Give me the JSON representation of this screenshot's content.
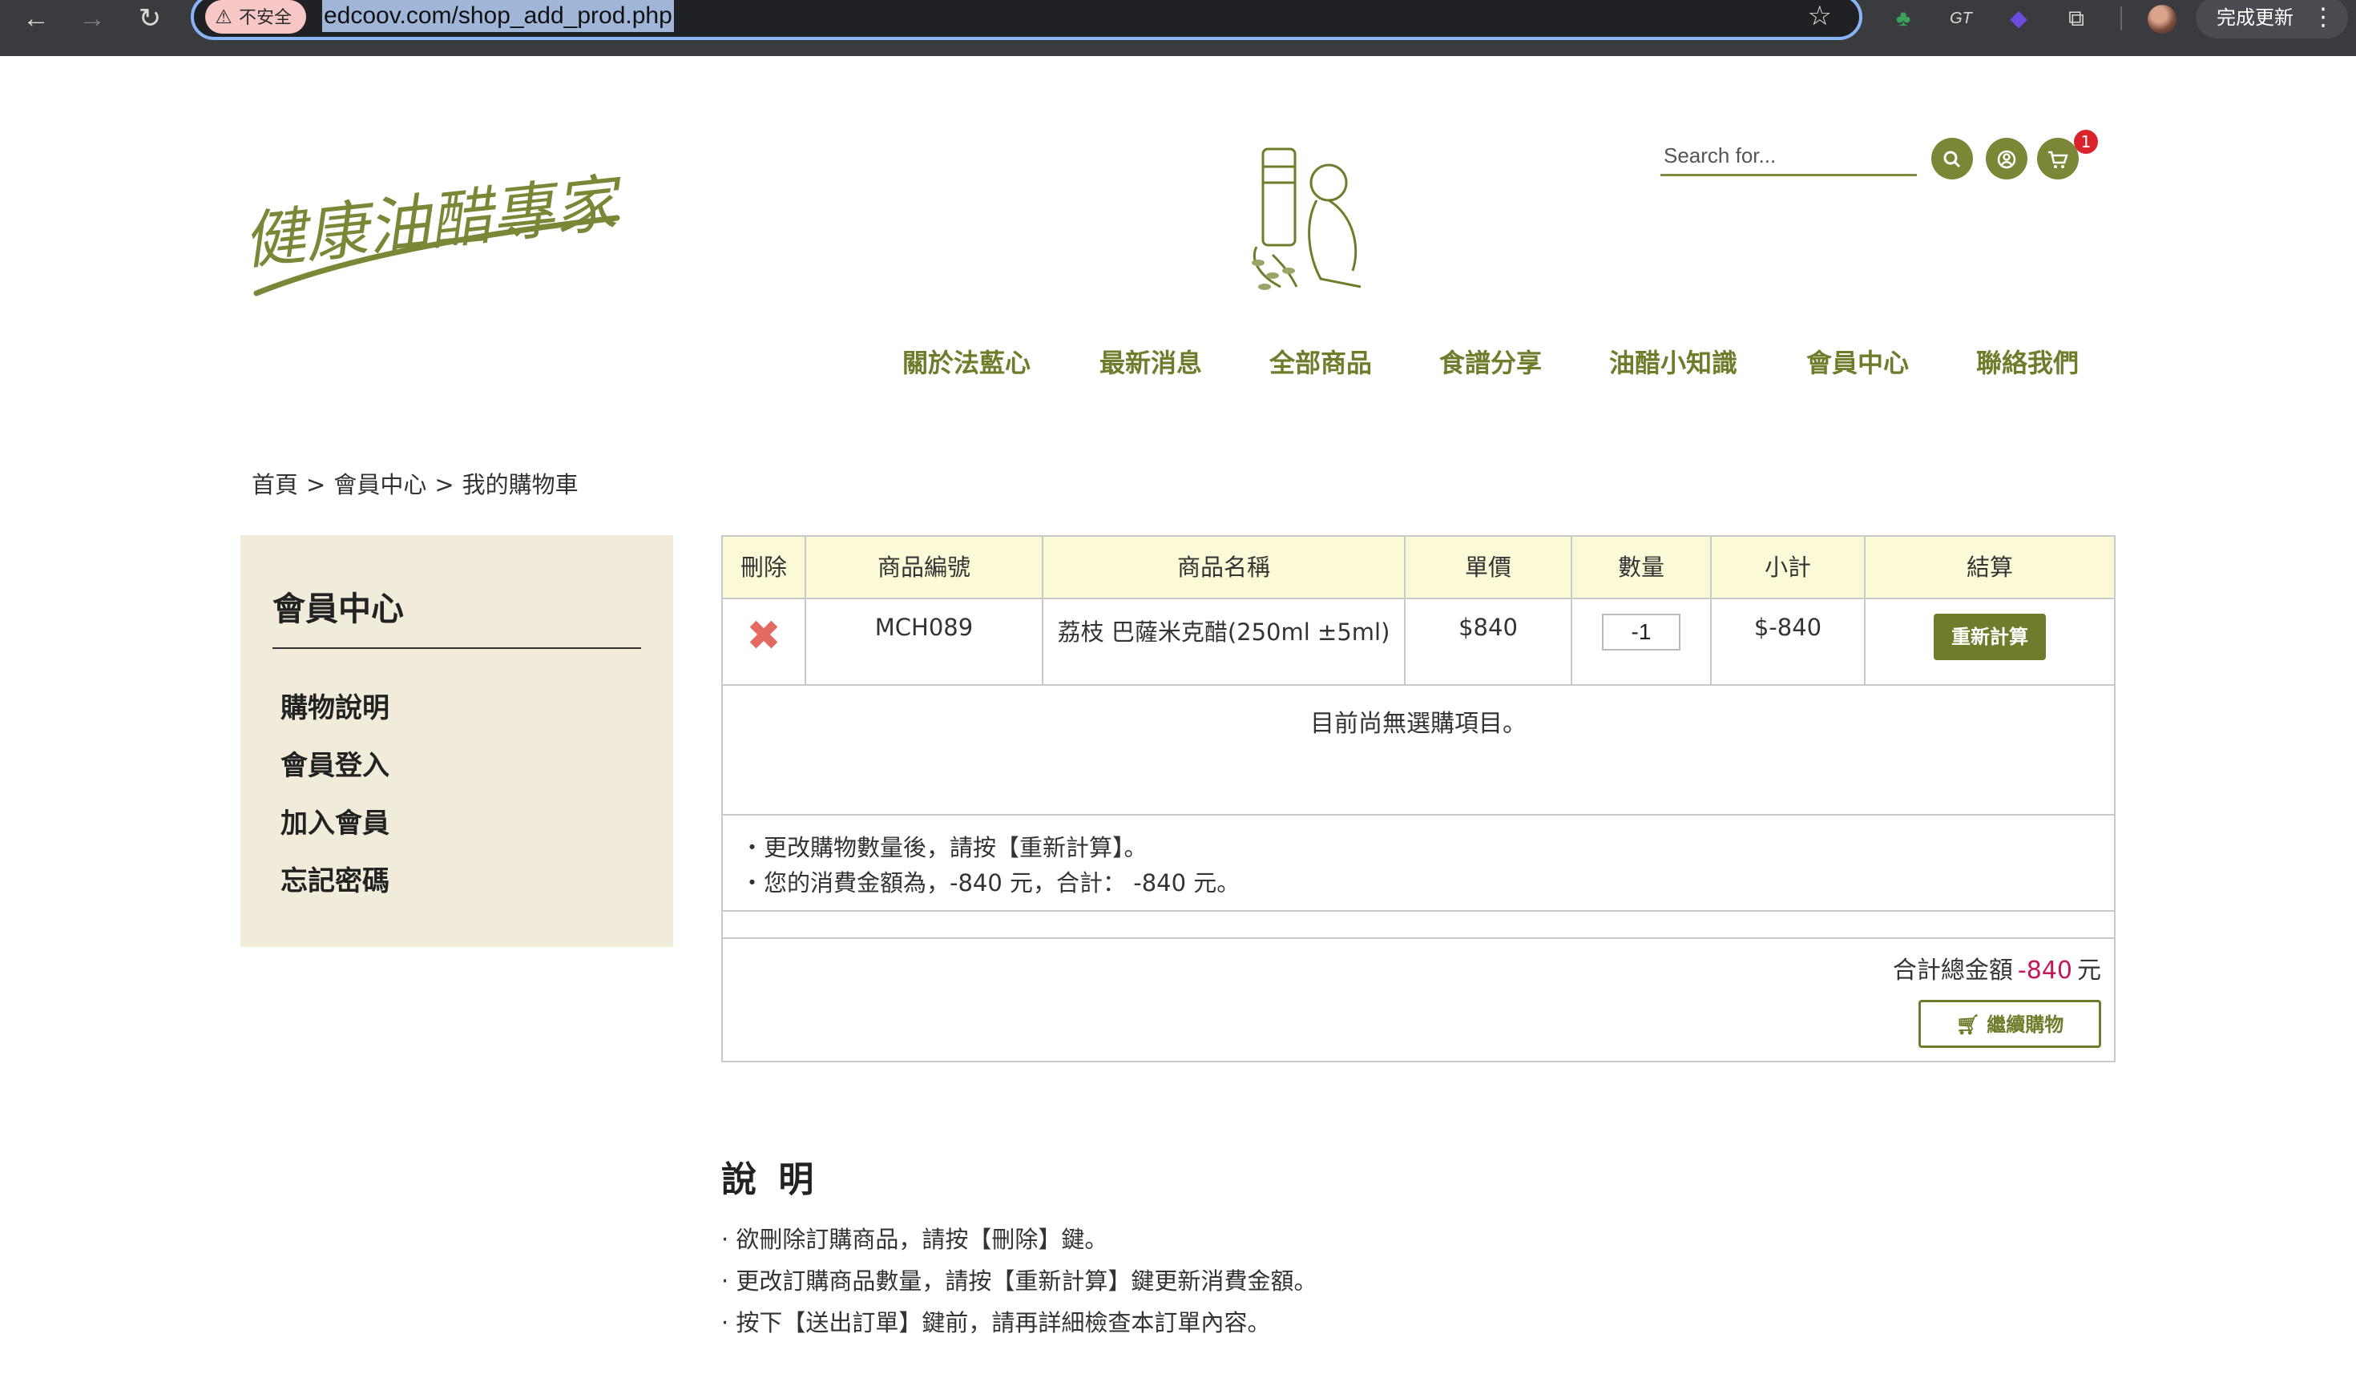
{
  "browser": {
    "security_label": "不安全",
    "url": "edcoov.com/shop_add_prod.php",
    "update_label": "完成更新",
    "back_glyph": "←",
    "forward_glyph": "→",
    "reload_glyph": "↻",
    "star_glyph": "☆",
    "menu_glyph": "⋮",
    "extensions": [
      {
        "name": "tree-extension-icon",
        "glyph": "♣",
        "color": "#3aa35a"
      },
      {
        "name": "gt-extension-icon",
        "glyph": "GT",
        "color": "#e0e0e0"
      },
      {
        "name": "purple-extension-icon",
        "glyph": "◆",
        "color": "#6c4ce0"
      },
      {
        "name": "puzzle-extension-icon",
        "glyph": "⧉",
        "color": "#d8d8d8"
      }
    ]
  },
  "header": {
    "logo_text": "健康油醋專家",
    "search_placeholder": "Search for...",
    "cart_count": "1",
    "accent": "#7b8636"
  },
  "nav": {
    "items": [
      {
        "label": "關於法藍心"
      },
      {
        "label": "最新消息"
      },
      {
        "label": "全部商品"
      },
      {
        "label": "食譜分享"
      },
      {
        "label": "油醋小知識"
      },
      {
        "label": "會員中心"
      },
      {
        "label": "聯絡我們"
      }
    ]
  },
  "breadcrumb": {
    "items": [
      "首頁",
      "會員中心",
      "我的購物車"
    ],
    "separator": ">"
  },
  "sidebar": {
    "title": "會員中心",
    "items": [
      {
        "label": "購物說明"
      },
      {
        "label": "會員登入"
      },
      {
        "label": "加入會員"
      },
      {
        "label": "忘記密碼"
      }
    ]
  },
  "cart": {
    "columns": [
      "刪除",
      "商品編號",
      "商品名稱",
      "單價",
      "數量",
      "小計",
      "結算"
    ],
    "rows": [
      {
        "code": "MCH089",
        "name": "荔枝 巴薩米克醋(250ml ±5ml)",
        "price": "$840",
        "quantity": "-1",
        "subtotal": "$-840",
        "action_label": "重新計算"
      }
    ],
    "empty_message": "目前尚無選購項目。",
    "notes": [
      "・更改購物數量後，請按【重新計算】。",
      "・您的消費金額為，-840 元，合計： -840 元。"
    ],
    "total_label": "合計總金額",
    "total_amount": "-840",
    "total_unit": "元",
    "continue_label": "繼續購物"
  },
  "instructions": {
    "title": "說 明",
    "lines": [
      "· 欲刪除訂購商品，請按【刪除】鍵。",
      "· 更改訂購商品數量，請按【重新計算】鍵更新消費金額。",
      "· 按下【送出訂單】鍵前，請再詳細檢查本訂單內容。"
    ]
  }
}
